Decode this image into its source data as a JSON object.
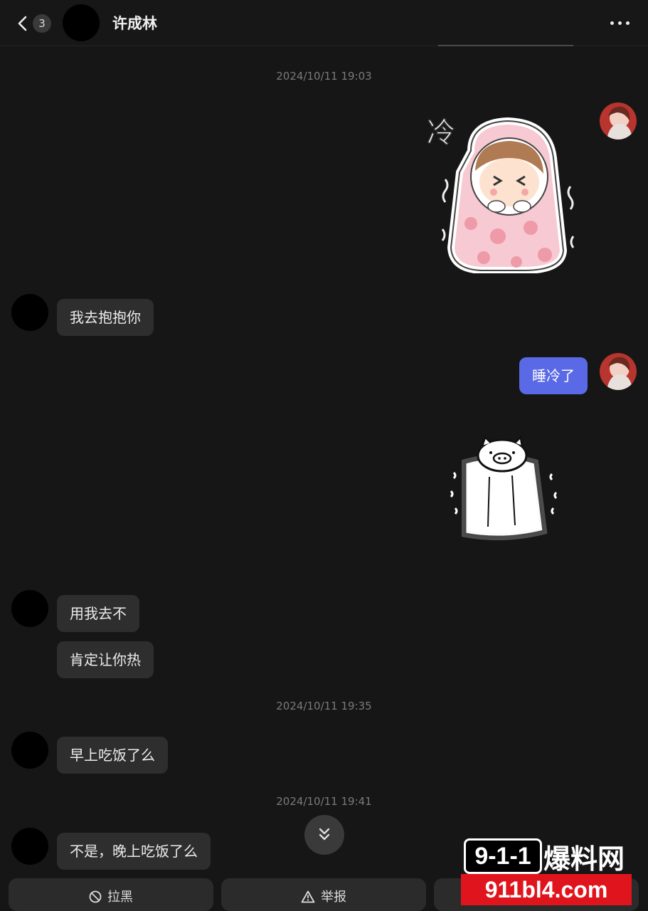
{
  "header": {
    "unread_badge": "3",
    "contact_name": "许成林"
  },
  "timestamps": [
    "2024/10/11 19:03",
    "2024/10/11 19:35",
    "2024/10/11 19:41"
  ],
  "messages": {
    "m1_sticker_text": "冷",
    "m2": "我去抱抱你",
    "m3": "睡冷了",
    "m5": "用我去不",
    "m6": "肯定让你热",
    "m7": "早上吃饭了么",
    "m8": "不是，晚上吃饭了么"
  },
  "actions": {
    "block_label": "拉黑",
    "report_label": "举报"
  },
  "watermark": {
    "box_text": "9-1-1",
    "cn_text": "爆料网",
    "url": "911bl4.com"
  },
  "colors": {
    "background": "#161616",
    "bubble_received": "#2e2e2e",
    "bubble_sent": "#5a6ae6"
  }
}
